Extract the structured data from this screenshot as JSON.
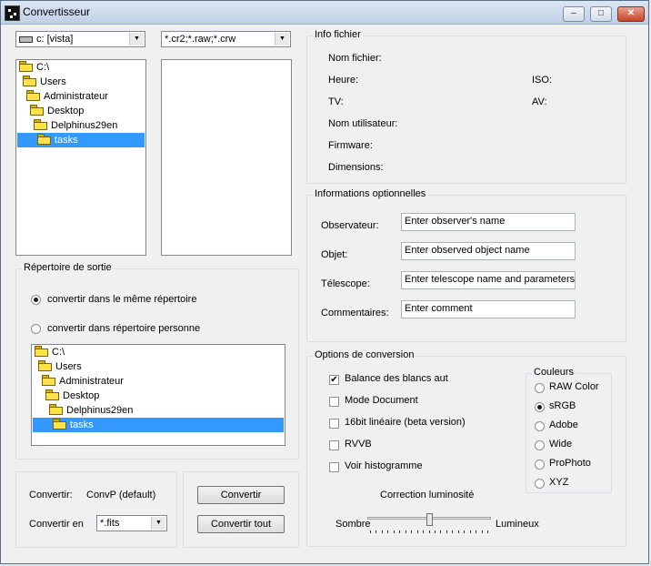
{
  "window": {
    "title": "Convertisseur",
    "minimize": "–",
    "maximize": "□",
    "close": "✕"
  },
  "drive_select": {
    "value": "c: [vista]"
  },
  "filter_select": {
    "value": "*.cr2;*.raw;*.crw"
  },
  "source_tree": {
    "items": [
      "C:\\",
      "Users",
      "Administrateur",
      "Desktop",
      "Delphinus29en",
      "tasks"
    ],
    "selected": "tasks"
  },
  "output_dir": {
    "title": "Répertoire de sortie",
    "option_same": "convertir dans le même répertoire",
    "option_custom": "convertir dans répertoire personne",
    "tree": [
      "C:\\",
      "Users",
      "Administrateur",
      "Desktop",
      "Delphinus29en",
      "tasks"
    ]
  },
  "convert": {
    "converter_label": "Convertir:",
    "converter_value": "ConvP (default)",
    "format_label": "Convertir en",
    "format_value": "*.fits"
  },
  "buttons": {
    "convert": "Convertir",
    "convert_all": "Convertir tout"
  },
  "file_info": {
    "title": "Info fichier",
    "labels": {
      "filename": "Nom fichier:",
      "time": "Heure:",
      "tv": "TV:",
      "user": "Nom utilisateur:",
      "firmware": "Firmware:",
      "dimensions": "Dimensions:",
      "iso": "ISO:",
      "av": "AV:"
    }
  },
  "optional_info": {
    "title": "Informations optionnelles",
    "observer_label": "Observateur:",
    "observer_value": "Enter observer's name",
    "object_label": "Objet:",
    "object_value": "Enter observed object name",
    "telescope_label": "Télescope:",
    "telescope_value": "Enter telescope name and parameters",
    "comments_label": "Commentaires:",
    "comments_value": "Enter comment"
  },
  "conversion_options": {
    "title": "Options de conversion",
    "white_balance": "Balance des blancs aut",
    "document_mode": "Mode Document",
    "linear16": "16bit linéaire (beta version)",
    "rwb": "RVVB",
    "histogram": "Voir histogramme",
    "checked": {
      "white_balance": true,
      "document_mode": false,
      "linear16": false,
      "rwb": false,
      "histogram": false
    },
    "colors": {
      "title": "Couleurs",
      "options": [
        "RAW Color",
        "sRGB",
        "Adobe",
        "Wide",
        "ProPhoto",
        "XYZ"
      ],
      "selected": "sRGB"
    },
    "brightness": {
      "title": "Correction luminosité",
      "min_label": "Sombre",
      "max_label": "Lumineux",
      "level": 0.5
    }
  }
}
